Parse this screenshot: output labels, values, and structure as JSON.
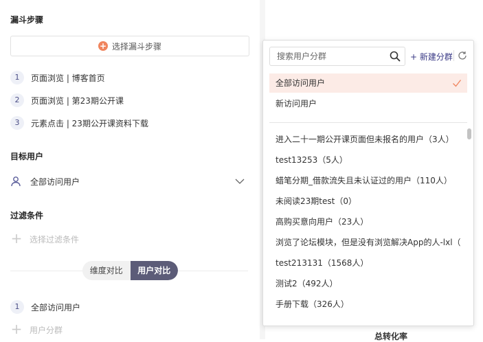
{
  "funnel": {
    "title": "漏斗步骤",
    "select_label": "选择漏斗步骤",
    "steps": [
      {
        "num": "1",
        "label": "页面浏览 | 博客首页"
      },
      {
        "num": "2",
        "label": "页面浏览 | 第23期公开课"
      },
      {
        "num": "3",
        "label": "元素点击 | 23期公开课资料下载"
      }
    ]
  },
  "target": {
    "title": "目标用户",
    "value": "全部访问用户"
  },
  "filter": {
    "title": "过滤条件",
    "add_label": "选择过滤条件"
  },
  "compare": {
    "dimension": "维度对比",
    "user": "用户对比"
  },
  "user_compare": {
    "num": "1",
    "item": "全部访问用户",
    "add_label": "用户分群"
  },
  "right": {
    "bottom_label": "总转化率"
  },
  "dropdown": {
    "search_placeholder": "搜索用户分群",
    "new_group": "+ 新建分群",
    "options": [
      {
        "label": "全部访问用户",
        "selected": true
      },
      {
        "label": "新访问用户",
        "selected": false
      }
    ],
    "groups": [
      "进入二十一期公开课页面但未报名的用户（3人）",
      "test13253（5人）",
      "蜡笔分期_借款流失且未认证过的用户（110人）",
      "未阅读23期test（0）",
      "高购买意向用户（23人）",
      "浏览了论坛模块，但是没有浏览解决App的人-lxl（5",
      "test213131（1568人）",
      "测试2（492人）",
      "手册下载（326人）"
    ]
  },
  "colors": {
    "accent": "#f0855e",
    "selected_bg": "#fcebe6",
    "toggle_active": "#5c5c78",
    "link": "#3a3a86"
  }
}
